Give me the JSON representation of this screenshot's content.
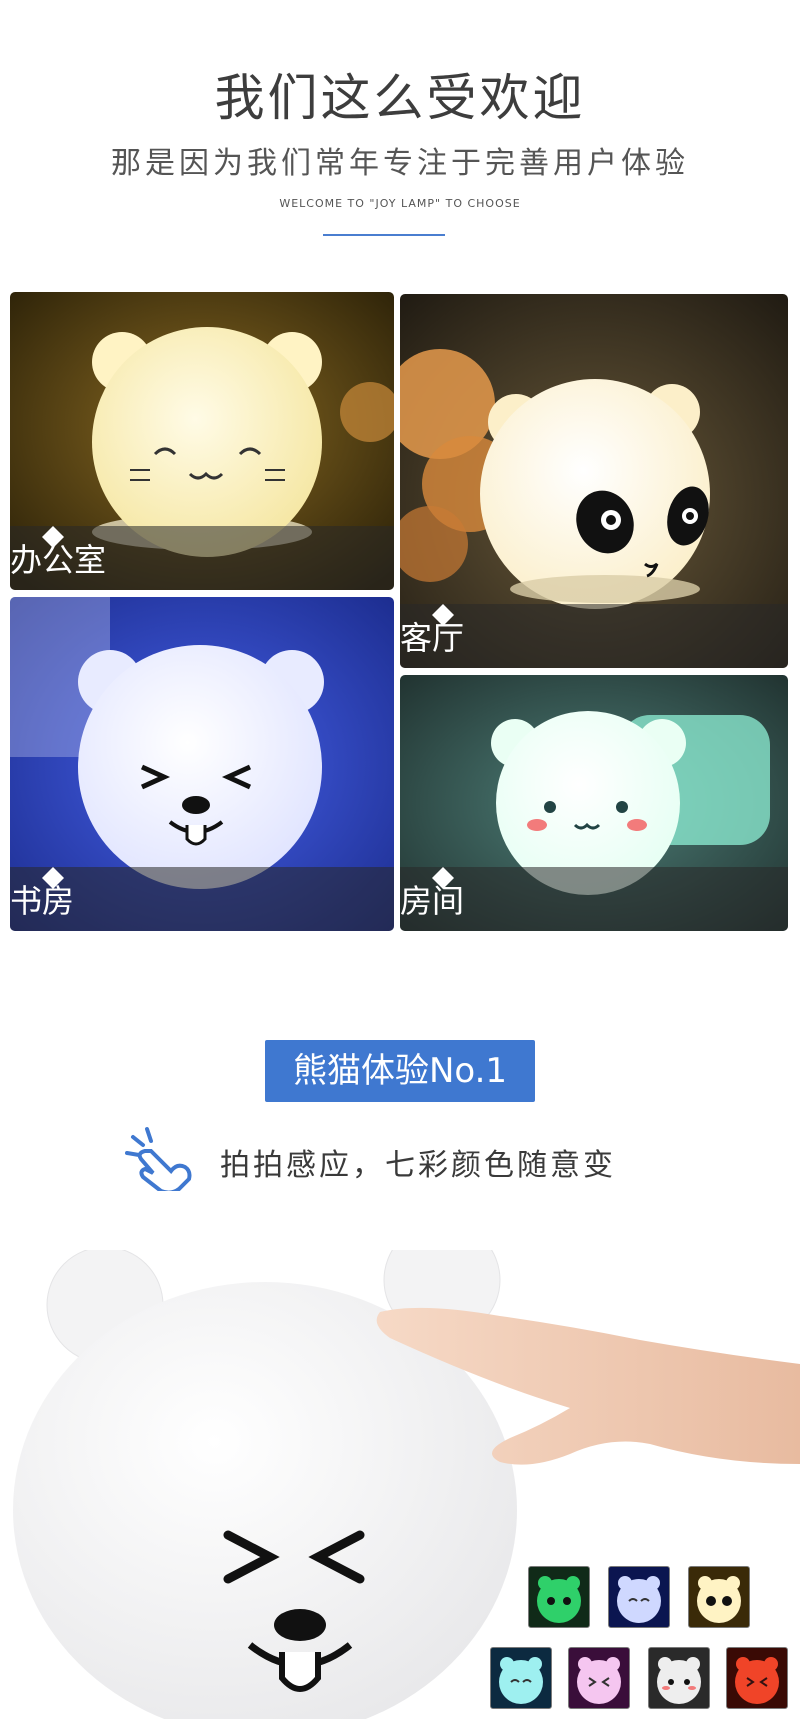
{
  "header": {
    "title": "我们这么受欢迎",
    "subtitle": "那是因为我们常年专注于完善用户体验",
    "tagline": "WELCOME TO \"JOY LAMP\" TO CHOOSE"
  },
  "gallery": [
    {
      "label": "办公室",
      "face": "cat",
      "glow": "#fff4c2",
      "bg": "#5a4418"
    },
    {
      "label": "客厅",
      "face": "panda",
      "glow": "#fff6dc",
      "bg": "#3a3020"
    },
    {
      "label": "书房",
      "face": "bear-squint",
      "glow": "#f2f3ff",
      "bg": "#2a3fb8"
    },
    {
      "label": "房间",
      "face": "bear-blush",
      "glow": "#f0fff8",
      "bg": "#3d6b66"
    }
  ],
  "feature": {
    "badge": "熊猫体验No.1",
    "tap_text": "拍拍感应，七彩颜色随意变",
    "tap_icon": "hand-tap-icon"
  },
  "colors": {
    "accent": "#3f78d0",
    "variants": [
      "#2fd06a",
      "#6b86f0",
      "#f3d27a",
      "#6fd9e0",
      "#d86bd8",
      "#eeeeee",
      "#f04428"
    ]
  }
}
